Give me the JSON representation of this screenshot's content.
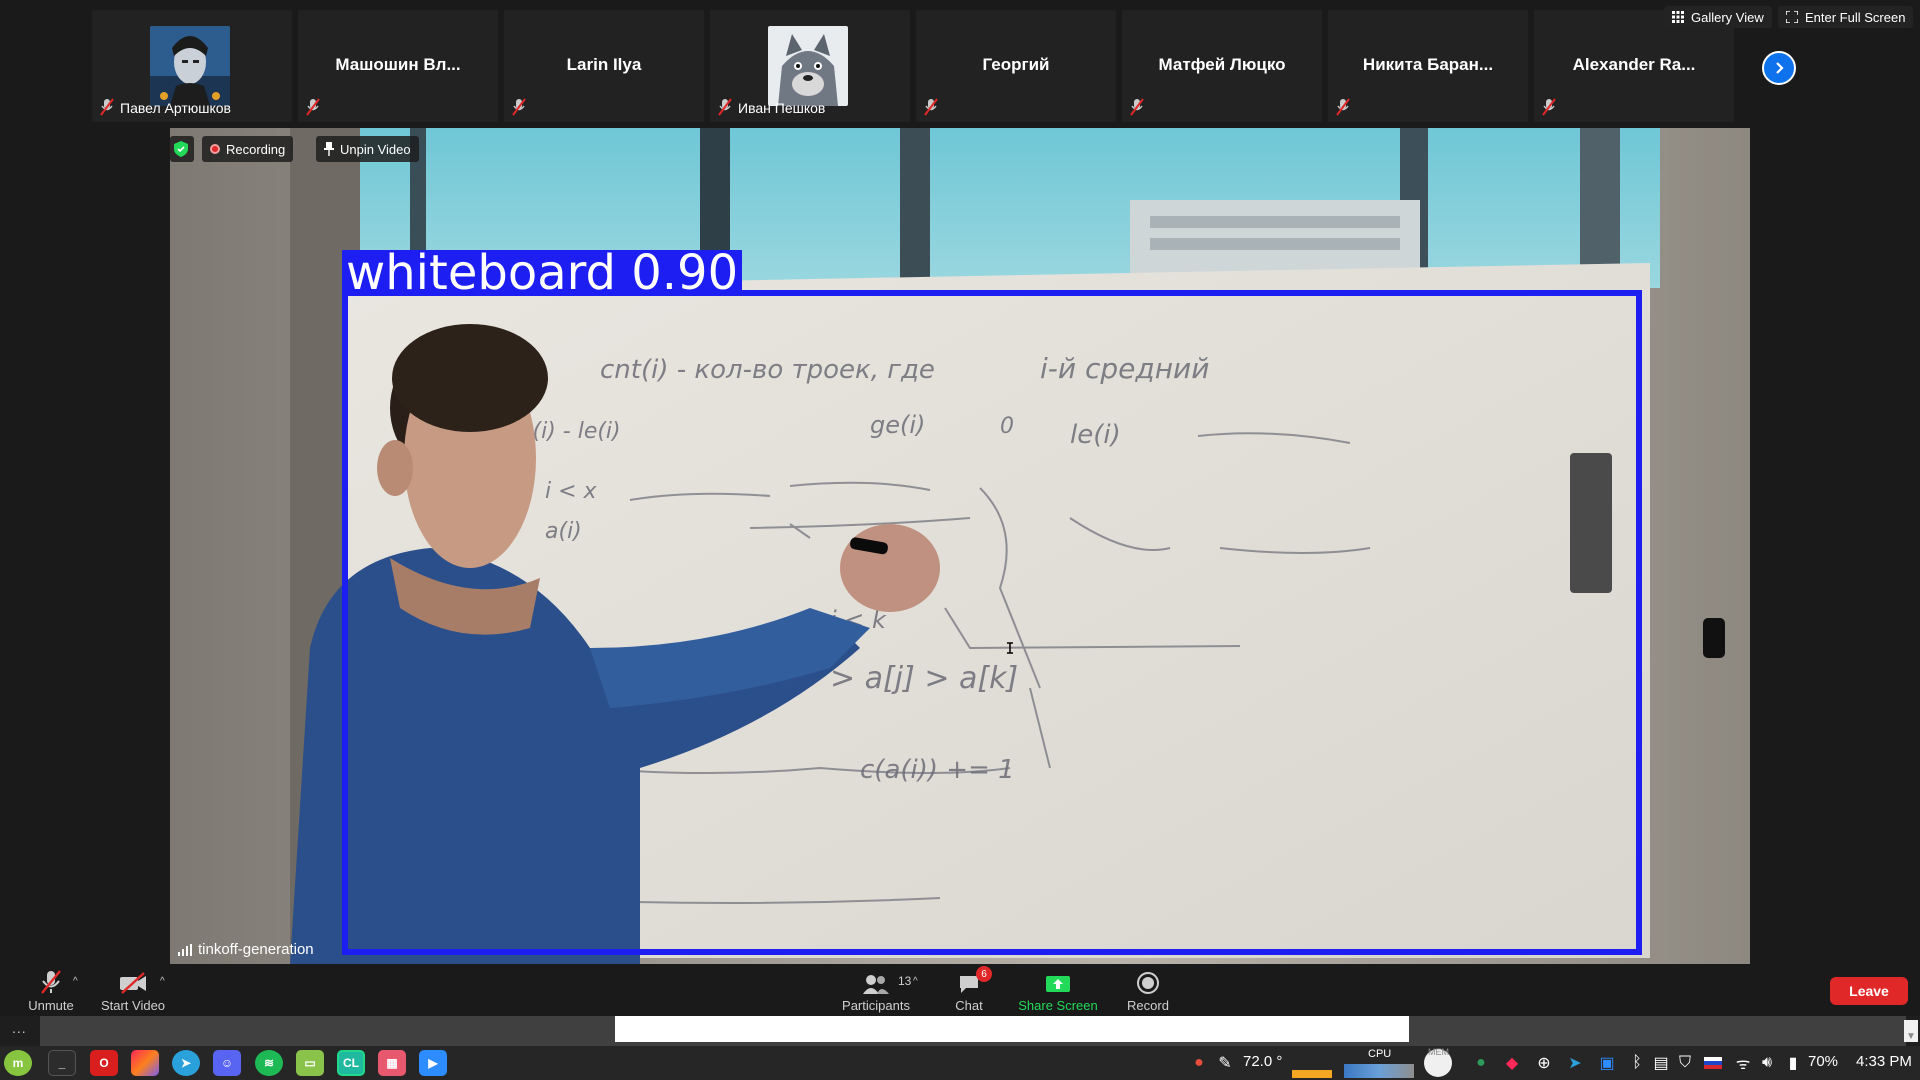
{
  "top_bar": {
    "gallery_view_label": "Gallery View",
    "full_screen_label": "Enter Full Screen"
  },
  "participants_strip": [
    {
      "name": "Павел Артюшков",
      "has_avatar": true,
      "avatar": "caricature-portrait",
      "muted": true
    },
    {
      "name": "Машошин Вл...",
      "has_avatar": false,
      "muted": true
    },
    {
      "name": "Larin Ilya",
      "has_avatar": false,
      "muted": true
    },
    {
      "name": "Иван Пешков",
      "has_avatar": true,
      "avatar": "wolf-cartoon",
      "muted": true
    },
    {
      "name": "Георгий",
      "has_avatar": false,
      "muted": true
    },
    {
      "name": "Матфей Люцко",
      "has_avatar": false,
      "muted": true
    },
    {
      "name": "Никита Баран...",
      "has_avatar": false,
      "muted": true
    },
    {
      "name": "Alexander Ra...",
      "has_avatar": false,
      "muted": true
    }
  ],
  "video": {
    "recording_label": "Recording",
    "unpin_label": "Unpin Video",
    "speaker_name": "tinkoff-generation",
    "detection": {
      "label": "whiteboard 0.90",
      "color": "#1c1ef2"
    },
    "whiteboard_writing": [
      "cnt(i) - кол-во троек, где i-й средний",
      "ge(i)",
      "0",
      "le(i)",
      "ge(i) - le(i)",
      "i < x",
      "a(i)",
      "j < k",
      "> a[j] > a[k]",
      "c(a(i)) += 1"
    ]
  },
  "controls": {
    "unmute_label": "Unmute",
    "start_video_label": "Start Video",
    "participants_label": "Participants",
    "participants_count": "13",
    "chat_label": "Chat",
    "chat_unread": "6",
    "share_screen_label": "Share Screen",
    "record_label": "Record",
    "leave_label": "Leave",
    "more_label": "..."
  },
  "taskbar": {
    "apps": [
      "mint-menu",
      "terminal",
      "opera",
      "jetbrains-toolbox",
      "telegram",
      "discord",
      "spotify",
      "files",
      "clion",
      "app-grid",
      "zoom"
    ],
    "temperature": "72.0 °",
    "cpu_label": "CPU",
    "mem_label": "MEM",
    "battery": "70%",
    "time": "4:33 PM"
  },
  "colors": {
    "zoom_blue": "#0e72ed",
    "leave_red": "#e02828",
    "share_green": "#23d959"
  }
}
